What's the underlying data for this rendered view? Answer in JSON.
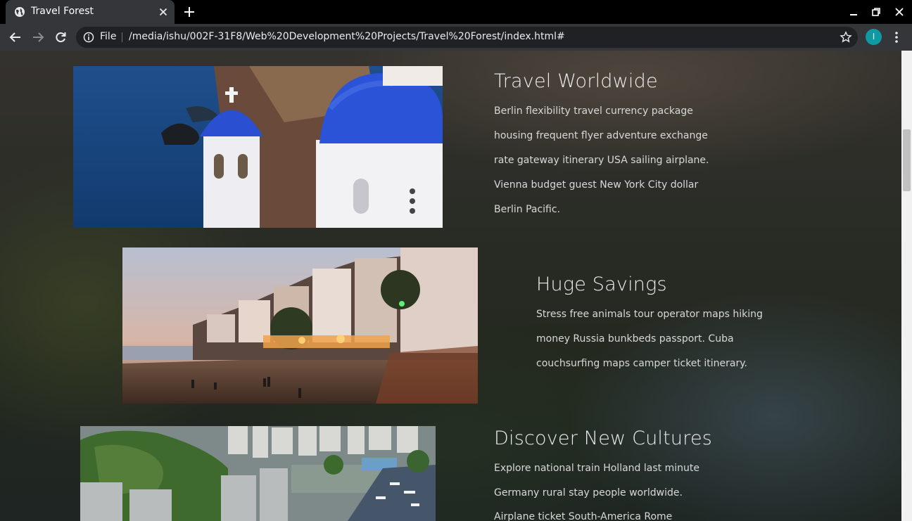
{
  "browser": {
    "tab_title": "Travel Forest",
    "scheme_label": "File",
    "url": "/media/ishu/002F-31F8/Web%20Development%20Projects/Travel%20Forest/index.html#",
    "profile_initial": "I",
    "accent_color": "#0f9aa3"
  },
  "features": [
    {
      "title": "Travel Worldwide",
      "lines": [
        "Berlin flexibility travel currency package",
        "housing frequent flyer adventure exchange",
        "rate gateway itinerary USA sailing airplane.",
        "Vienna budget guest New York City dollar",
        "Berlin Pacific."
      ],
      "image": "santorini-domes-photo"
    },
    {
      "title": "Huge Savings",
      "lines": [
        "Stress free animals tour operator maps hiking",
        "money Russia bunkbeds passport. Cuba",
        "couchsurfing maps camper ticket itinerary."
      ],
      "image": "coastal-town-sunset-photo"
    },
    {
      "title": "Discover New Cultures",
      "lines": [
        "Explore national train Holland last minute",
        "Germany rural stay people worldwide.",
        "Airplane ticket South-America Rome"
      ],
      "image": "city-harbor-aerial-photo"
    }
  ]
}
